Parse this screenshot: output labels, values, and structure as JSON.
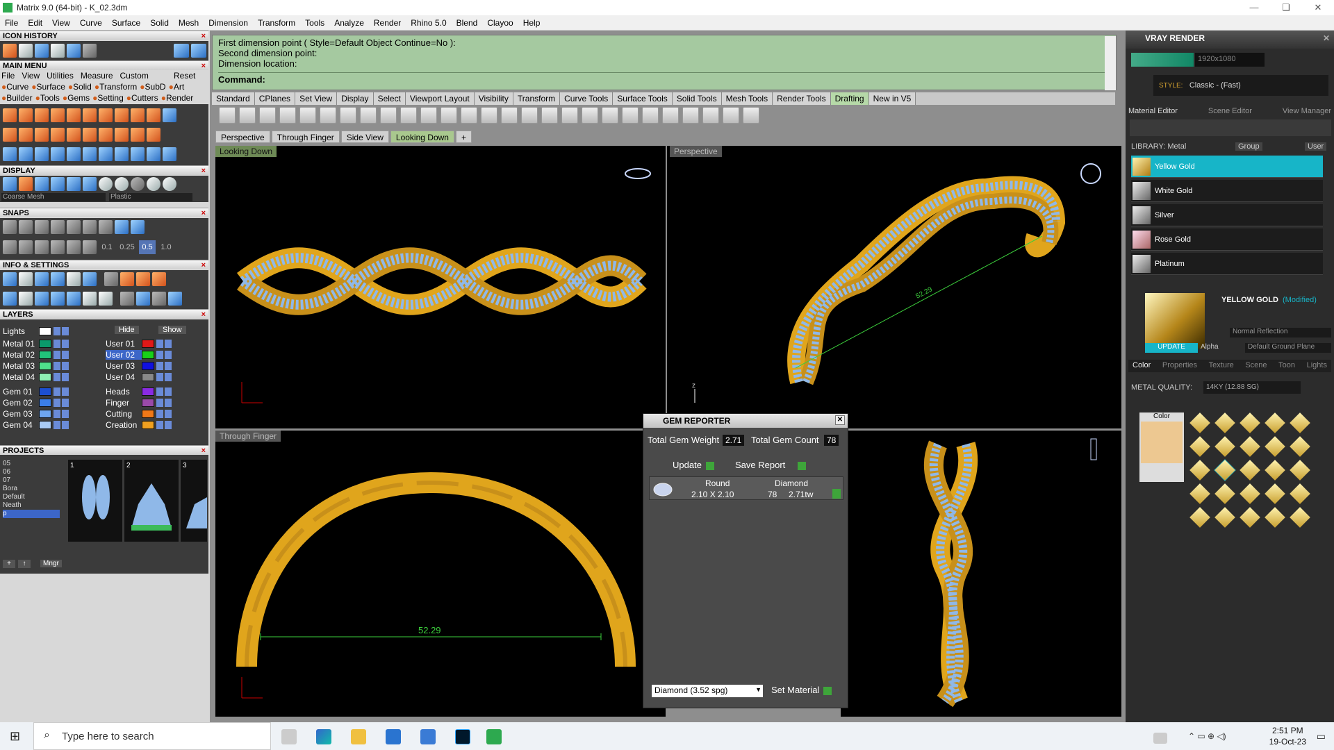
{
  "window": {
    "title": "Matrix 9.0 (64-bit) - K_02.3dm"
  },
  "menubar": [
    "File",
    "Edit",
    "View",
    "Curve",
    "Surface",
    "Solid",
    "Mesh",
    "Dimension",
    "Transform",
    "Tools",
    "Analyze",
    "Render",
    "Rhino 5.0",
    "Blend",
    "Clayoo",
    "Help"
  ],
  "left": {
    "icon_history": "ICON HISTORY",
    "main_menu": "MAIN MENU",
    "main_menu_items": [
      "File",
      "View",
      "Utilities",
      "Measure",
      "Custom"
    ],
    "reset": "Reset",
    "row1": [
      "Curve",
      "Surface",
      "Solid",
      "Transform",
      "SubD",
      "Art"
    ],
    "row2": [
      "Builder",
      "Tools",
      "Gems",
      "Setting",
      "Cutters",
      "Render"
    ],
    "display": "DISPLAY",
    "display_mode": "Coarse Mesh",
    "display_material": "Plastic",
    "snaps": "SNAPS",
    "snap_values": [
      "0.1",
      "0.25",
      "0.5",
      "1.0"
    ],
    "info": "INFO & SETTINGS",
    "layers": "LAYERS",
    "lights": "Lights",
    "hide": "Hide",
    "show": "Show",
    "layers_left": [
      "Metal 01",
      "Metal 02",
      "Metal 03",
      "Metal 04",
      "Gem 01",
      "Gem 02",
      "Gem 03",
      "Gem 04"
    ],
    "layers_right": [
      "User 01",
      "User 02",
      "User 03",
      "User 04",
      "Heads",
      "Finger",
      "Cutting",
      "Creation"
    ],
    "projects": "PROJECTS",
    "project_list": [
      "05",
      "06",
      "07",
      "Bora",
      "Default",
      "Neath",
      "p"
    ],
    "project_nums": [
      "1",
      "2",
      "3"
    ],
    "mngr": "Mngr"
  },
  "command": {
    "line1": "First dimension point ( Style=Default  Object  Continue=No ):",
    "line2": "Second dimension point:",
    "line3": "Dimension location:",
    "prompt": "Command:"
  },
  "tabs": [
    "Standard",
    "CPlanes",
    "Set View",
    "Display",
    "Select",
    "Viewport Layout",
    "Visibility",
    "Transform",
    "Curve Tools",
    "Surface Tools",
    "Solid Tools",
    "Mesh Tools",
    "Render Tools",
    "Drafting",
    "New in V5"
  ],
  "viewtabs": [
    "Perspective",
    "Through Finger",
    "Side View",
    "Looking Down"
  ],
  "viewports": {
    "top_left": "Looking Down",
    "top_right": "Perspective",
    "bottom_left": "Through Finger",
    "dimension": "52.29",
    "dim_small": "52.29"
  },
  "gem_reporter": {
    "title": "GEM REPORTER",
    "total_weight_label": "Total Gem Weight",
    "total_weight": "2.71",
    "total_count_label": "Total Gem Count",
    "total_count": "78",
    "update": "Update",
    "save_report": "Save Report",
    "col_shape": "Round",
    "col_material": "Diamond",
    "size": "2.10 X 2.10",
    "count": "78",
    "tw": "2.71tw",
    "material_select": "Diamond    (3.52 spg)",
    "set_material": "Set Material"
  },
  "right": {
    "title": "VRAY RENDER",
    "resolution": "1920x1080",
    "style_label": "STYLE:",
    "style": "Classic - (Fast)",
    "tabs": [
      "Material Editor",
      "Scene Editor",
      "View Manager"
    ],
    "library": "LIBRARY: Metal",
    "group": "Group",
    "user": "User",
    "materials": [
      "Yellow Gold",
      "White Gold",
      "Silver",
      "Rose Gold",
      "Platinum"
    ],
    "material_name": "YELLOW GOLD",
    "modified": "(Modified)",
    "normal_reflection": "Normal Reflection",
    "update": "UPDATE",
    "alpha": "Alpha",
    "ground": "Default Ground Plane",
    "subtabs": [
      "Color",
      "Properties",
      "Texture",
      "Scene",
      "Toon",
      "Lights"
    ],
    "metal_quality_label": "METAL QUALITY:",
    "metal_quality": "14KY          (12.88 SG)",
    "color_label": "Color"
  },
  "taskbar": {
    "search_placeholder": "Type here to search",
    "time": "2:51 PM",
    "date": "19-Oct-23"
  },
  "colors": {
    "gold": "#e0a51c",
    "gem": "#8fb8e8",
    "accent": "#17b5c8"
  }
}
